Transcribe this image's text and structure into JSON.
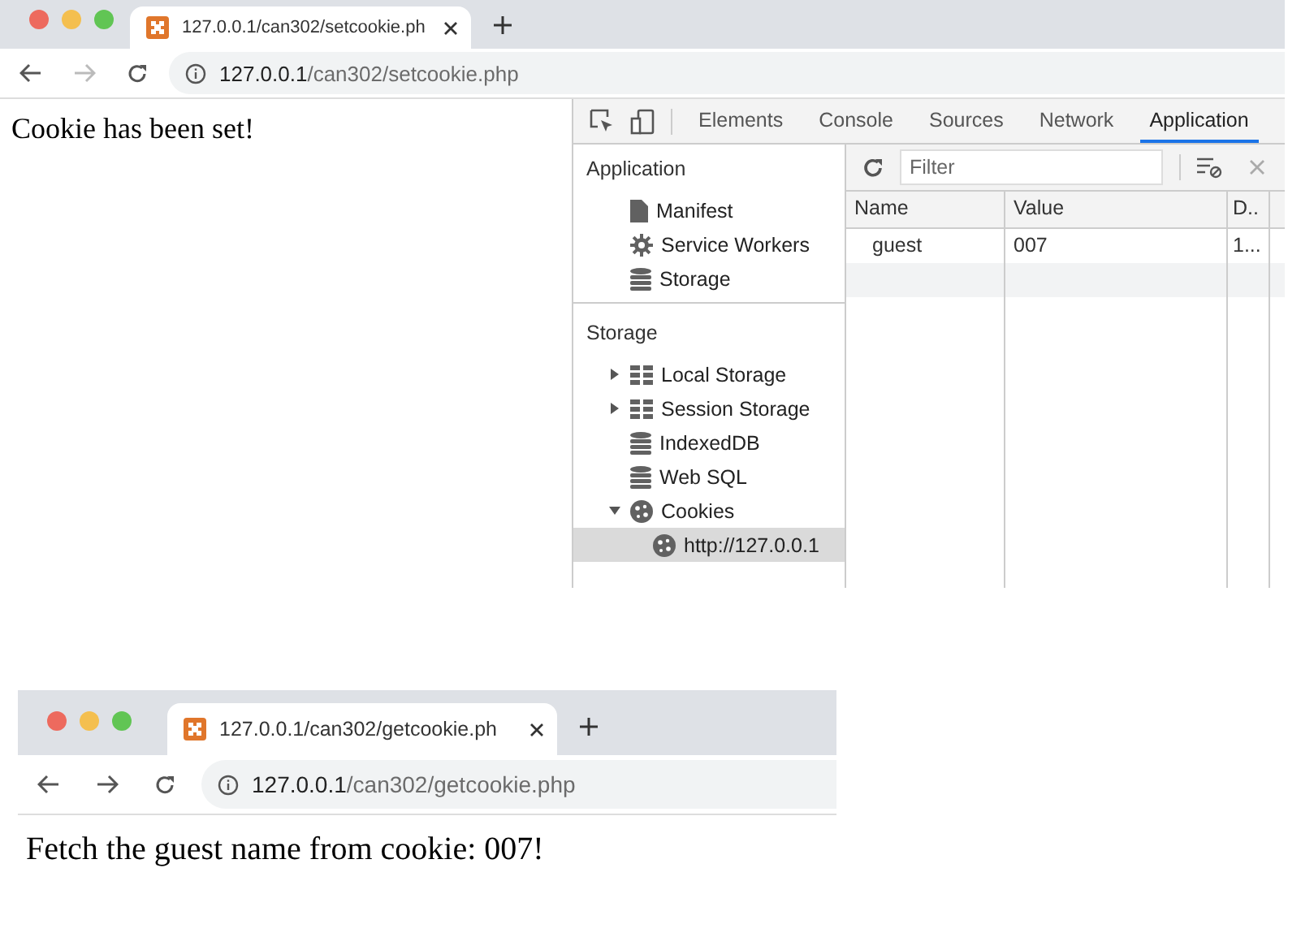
{
  "windows": [
    {
      "tab": {
        "title": "127.0.0.1/can302/setcookie.ph"
      },
      "address": {
        "host": "127.0.0.1",
        "path": "/can302/setcookie.php"
      },
      "forward_disabled": true,
      "page_text": "Cookie has been set!",
      "devtools": {
        "tabs": [
          {
            "label": "Elements",
            "selected": false
          },
          {
            "label": "Console",
            "selected": false
          },
          {
            "label": "Sources",
            "selected": false
          },
          {
            "label": "Network",
            "selected": false
          },
          {
            "label": "Application",
            "selected": true
          }
        ],
        "sidebar": [
          {
            "heading": "Application",
            "items": [
              {
                "label": "Manifest",
                "kind": "file",
                "selected": false
              },
              {
                "label": "Service Workers",
                "kind": "gear",
                "selected": false
              },
              {
                "label": "Storage",
                "kind": "database",
                "selected": false
              }
            ]
          },
          {
            "heading": "Storage",
            "items": [
              {
                "label": "Local Storage",
                "kind": "grid",
                "expanded": false,
                "selected": false
              },
              {
                "label": "Session Storage",
                "kind": "grid",
                "expanded": false,
                "selected": false
              },
              {
                "label": "IndexedDB",
                "kind": "database",
                "selected": false
              },
              {
                "label": "Web SQL",
                "kind": "database",
                "selected": false
              },
              {
                "label": "Cookies",
                "kind": "cookie",
                "expanded": true,
                "selected": false,
                "children": [
                  {
                    "label": "http://127.0.0.1",
                    "kind": "cookie",
                    "selected": true
                  }
                ]
              }
            ]
          }
        ],
        "filter": {
          "placeholder": "Filter"
        },
        "table": {
          "columns": [
            "Name",
            "Value",
            "D.."
          ],
          "rows": [
            [
              "guest",
              "007",
              "1..."
            ]
          ]
        }
      }
    },
    {
      "tab": {
        "title": "127.0.0.1/can302/getcookie.ph"
      },
      "address": {
        "host": "127.0.0.1",
        "path": "/can302/getcookie.php"
      },
      "forward_disabled": false,
      "page_text": "Fetch the guest name from cookie: 007!"
    }
  ]
}
